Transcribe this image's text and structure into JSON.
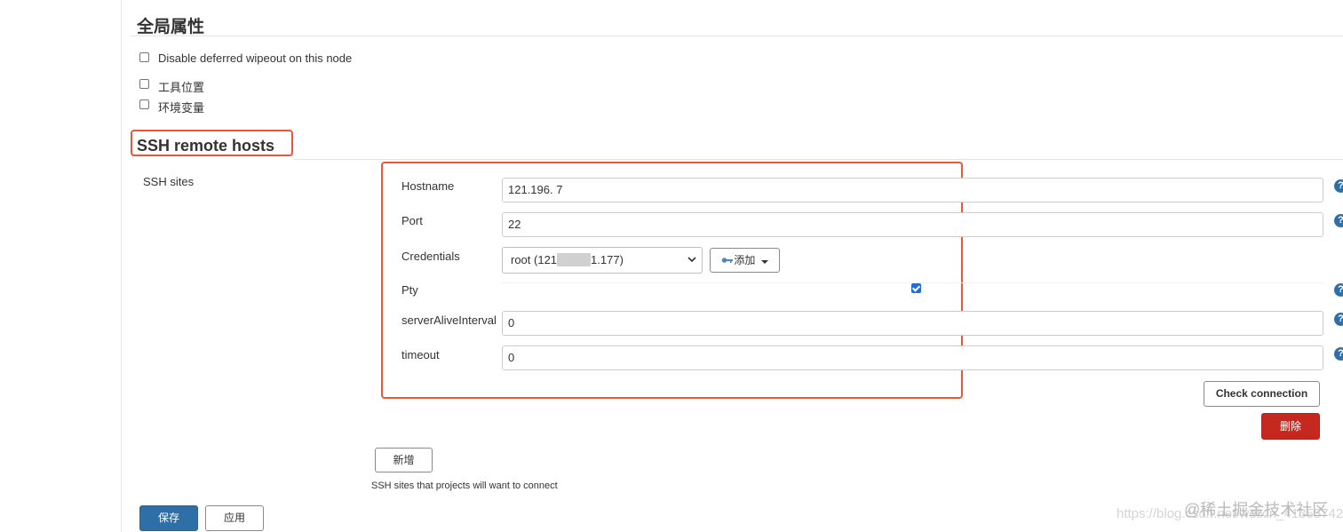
{
  "global_properties": {
    "title": "全局属性",
    "checkboxes": [
      {
        "label": "Disable deferred wipeout on this node",
        "checked": false
      },
      {
        "label": "工具位置",
        "checked": false
      },
      {
        "label": "环境变量",
        "checked": false
      }
    ]
  },
  "ssh_section": {
    "title": "SSH remote hosts",
    "sites_label": "SSH sites",
    "fields": {
      "hostname": {
        "label": "Hostname",
        "value": "121.196.        7"
      },
      "port": {
        "label": "Port",
        "value": "22"
      },
      "credentials": {
        "label": "Credentials",
        "value_prefix": "root (121",
        "value_suffix": "1.177)",
        "add_button": "添加"
      },
      "pty": {
        "label": "Pty",
        "checked": true
      },
      "server_alive_interval": {
        "label": "serverAliveInterval",
        "value": "0"
      },
      "timeout": {
        "label": "timeout",
        "value": "0"
      }
    },
    "check_connection_button": "Check connection",
    "delete_button": "删除",
    "add_site_button": "新增",
    "sites_description": "SSH sites that projects will want to connect"
  },
  "footer": {
    "save_button": "保存",
    "apply_button": "应用"
  },
  "watermark": {
    "brand": "@稀土掘金技术社区",
    "url": "https://blog.csdn.net/weixin_41355742"
  },
  "colors": {
    "highlight_box": "#e8573a",
    "primary": "#2f6fa8",
    "danger": "#c4281f",
    "checkbox_checked": "#1c6fe0"
  },
  "icons": {
    "help": "help-icon",
    "key": "key-icon",
    "caret": "caret-down-icon",
    "chevron": "chevron-down-icon"
  }
}
